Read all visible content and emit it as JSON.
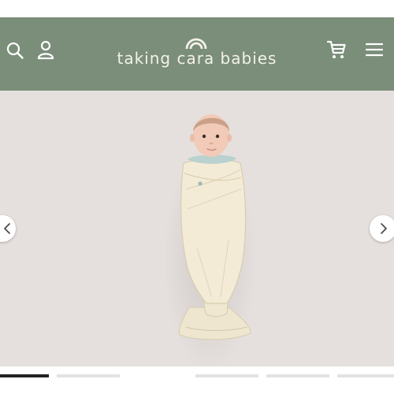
{
  "header": {
    "brand_name": "taking cara babies",
    "search_icon": "search-icon",
    "account_icon": "user-icon",
    "cart_icon": "cart-icon",
    "menu_icon": "hamburger-menu-icon",
    "logo_icon": "rainbow-icon"
  },
  "hero": {
    "image": "swaddled-baby-photo",
    "prev_icon": "chevron-left-icon",
    "next_icon": "chevron-right-icon"
  },
  "thumbnails": {
    "count": 5,
    "active_index": 0
  },
  "colors": {
    "header_bg": "#7a8e7a",
    "hero_bg": "#e5e0dd",
    "brand_text": "#f4f1ea",
    "swaddle": "#f2ead4",
    "onesie": "#b9d1cf"
  }
}
